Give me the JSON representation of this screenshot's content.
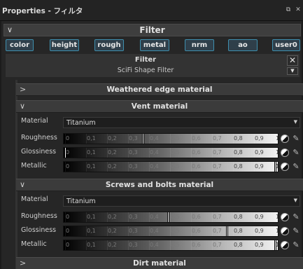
{
  "window": {
    "title": "Properties - フィルタ",
    "icons": [
      "pin-icon",
      "close-icon"
    ]
  },
  "filter_bar": {
    "label": "Filter"
  },
  "channels": [
    "color",
    "height",
    "rough",
    "metal",
    "nrm",
    "ao",
    "user0"
  ],
  "filter_header": {
    "title": "Filter",
    "subtitle": "SciFi Shape Filter"
  },
  "sections": {
    "weathered": {
      "label": "Weathered edge material"
    },
    "vent": {
      "label": "Vent material",
      "material_label": "Material",
      "material_value": "Titanium",
      "sliders": [
        {
          "label": "Roughness",
          "value": 0.37
        },
        {
          "label": "Glossiness",
          "value": 0.0
        },
        {
          "label": "Metallic",
          "value": 1.0
        }
      ]
    },
    "screws": {
      "label": "Screws and bolts material",
      "material_label": "Material",
      "material_value": "Titanium",
      "sliders": [
        {
          "label": "Roughness",
          "value": 0.49
        },
        {
          "label": "Glossiness",
          "value": 0.77
        },
        {
          "label": "Metallic",
          "value": 1.0
        }
      ]
    },
    "dirt": {
      "label": "Dirt material"
    }
  },
  "tick_labels": [
    "0",
    "0,1",
    "0,2",
    "0,3",
    "0,4",
    "0,5",
    "0,6",
    "0,7",
    "0,8",
    "0,9",
    "1"
  ]
}
